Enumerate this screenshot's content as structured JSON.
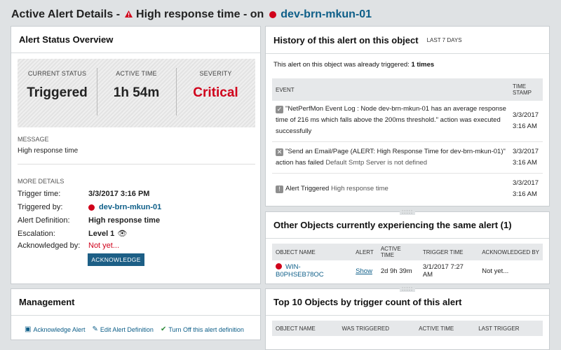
{
  "header": {
    "prefix": "Active Alert Details -",
    "alert_name": "High response time - on",
    "object_name": "dev-brn-mkun-01"
  },
  "overview": {
    "title": "Alert Status Overview",
    "current_status_label": "CURRENT STATUS",
    "current_status": "Triggered",
    "active_time_label": "ACTIVE TIME",
    "active_time": "1h 54m",
    "severity_label": "SEVERITY",
    "severity": "Critical",
    "message_label": "MESSAGE",
    "message": "High response time",
    "more_details_label": "MORE DETAILS",
    "trigger_time_label": "Trigger time:",
    "trigger_time": "3/3/2017 3:16 PM",
    "triggered_by_label": "Triggered by:",
    "triggered_by": "dev-brn-mkun-01",
    "alert_definition_label": "Alert Definition:",
    "alert_definition": "High response time",
    "escalation_label": "Escalation:",
    "escalation": "Level 1",
    "acknowledged_label": "Acknowledged by:",
    "acknowledged": "Not yet...",
    "ack_button": "ACKNOWLEDGE"
  },
  "history": {
    "title": "History of this alert on this object",
    "period": "LAST 7 DAYS",
    "summary_prefix": "This alert on this object was already triggered:",
    "summary_count": "1 times",
    "col_event": "EVENT",
    "col_timestamp": "TIME STAMP",
    "events": [
      {
        "icon": "check-icon",
        "text": "\"NetPerfMon Event Log : Node dev-brn-mkun-01 has an average response time of 216 ms which falls above the 200ms threshold.\" action was executed successfully",
        "extra": "",
        "date": "3/3/2017",
        "time": "3:16 AM"
      },
      {
        "icon": "x-icon",
        "text": "\"Send an Email/Page (ALERT: High Response Time for dev-brn-mkun-01)\" action has failed",
        "extra": "Default Smtp Server is not defined",
        "date": "3/3/2017",
        "time": "3:16 AM"
      },
      {
        "icon": "exclamation-icon",
        "text": "Alert Triggered",
        "extra": "High response time",
        "date": "3/3/2017",
        "time": "3:16 AM"
      }
    ]
  },
  "other_objects": {
    "title": "Other Objects currently experiencing the same alert (1)",
    "columns": [
      "OBJECT NAME",
      "ALERT",
      "ACTIVE TIME",
      "TRIGGER TIME",
      "ACKNOWLEDGED BY"
    ],
    "rows": [
      {
        "object": "WIN-B0PHSEB78OC",
        "alert": "Show",
        "active_time": "2d 9h 39m",
        "trigger_time": "3/1/2017 7:27 AM",
        "acknowledged": "Not yet..."
      }
    ]
  },
  "management": {
    "title": "Management",
    "ack_link": "Acknowledge Alert",
    "edit_link": "Edit Alert Definition",
    "turn_off_link": "Turn Off this alert definition"
  },
  "top10": {
    "title": "Top 10 Objects by trigger count of this alert",
    "columns": [
      "OBJECT NAME",
      "WAS TRIGGERED",
      "ACTIVE TIME",
      "LAST TRIGGER"
    ]
  },
  "colors": {
    "critical": "#d0021b",
    "link": "#0d5e88",
    "button": "#1d5f86"
  }
}
